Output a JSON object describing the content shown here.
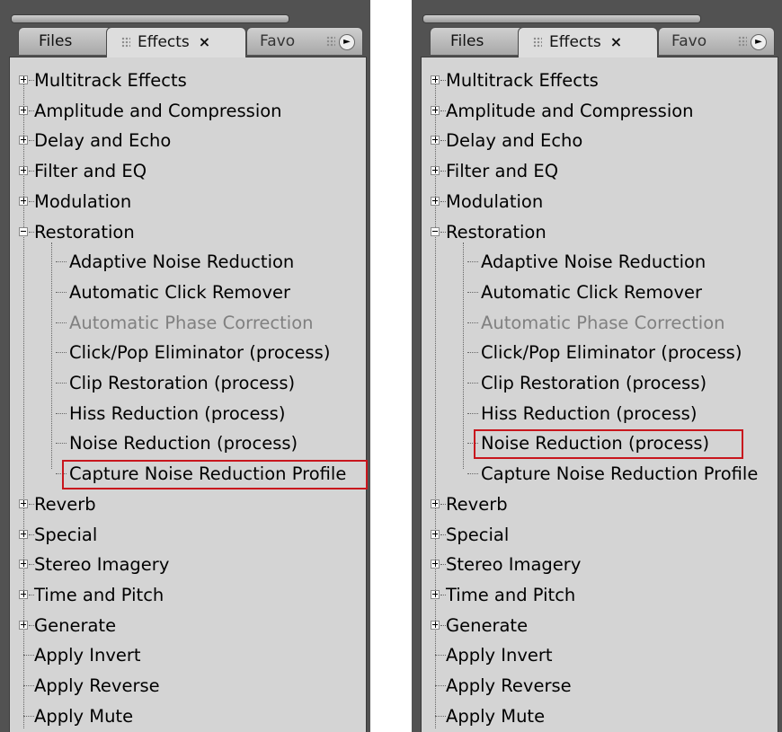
{
  "tabs": {
    "files": "Files",
    "effects": "Effects",
    "effects_close": "×",
    "favorites": "Favo",
    "menu_glyph": "►"
  },
  "tree": [
    {
      "label": "Multitrack Effects",
      "level": 0,
      "type": "collapsed"
    },
    {
      "label": "Amplitude and Compression",
      "level": 0,
      "type": "collapsed"
    },
    {
      "label": "Delay and Echo",
      "level": 0,
      "type": "collapsed"
    },
    {
      "label": "Filter and EQ",
      "level": 0,
      "type": "collapsed"
    },
    {
      "label": "Modulation",
      "level": 0,
      "type": "collapsed"
    },
    {
      "label": "Restoration",
      "level": 0,
      "type": "expanded"
    },
    {
      "label": "Adaptive Noise Reduction",
      "level": 1,
      "type": "leaf"
    },
    {
      "label": "Automatic Click Remover",
      "level": 1,
      "type": "leaf"
    },
    {
      "label": "Automatic Phase Correction",
      "level": 1,
      "type": "leaf",
      "disabled": true
    },
    {
      "label": "Click/Pop Eliminator (process)",
      "level": 1,
      "type": "leaf"
    },
    {
      "label": "Clip Restoration (process)",
      "level": 1,
      "type": "leaf"
    },
    {
      "label": "Hiss Reduction (process)",
      "level": 1,
      "type": "leaf"
    },
    {
      "label": "Noise Reduction (process)",
      "level": 1,
      "type": "leaf"
    },
    {
      "label": "Capture Noise Reduction Profile",
      "level": 1,
      "type": "leaf",
      "last_child": true
    },
    {
      "label": "Reverb",
      "level": 0,
      "type": "collapsed"
    },
    {
      "label": "Special",
      "level": 0,
      "type": "collapsed"
    },
    {
      "label": "Stereo Imagery",
      "level": 0,
      "type": "collapsed"
    },
    {
      "label": "Time and Pitch",
      "level": 0,
      "type": "collapsed"
    },
    {
      "label": "Generate",
      "level": 0,
      "type": "collapsed"
    },
    {
      "label": "Apply Invert",
      "level": 0,
      "type": "leaf"
    },
    {
      "label": "Apply Reverse",
      "level": 0,
      "type": "leaf"
    },
    {
      "label": "Apply Mute",
      "level": 0,
      "type": "leaf"
    }
  ],
  "panels": [
    {
      "id": "panel-left",
      "highlighted_item": "Capture Noise Reduction Profile"
    },
    {
      "id": "panel-right",
      "highlighted_item": "Noise Reduction (process)"
    }
  ],
  "colors": {
    "highlight": "#c8161d",
    "disabled_text": "#808080",
    "tree_background": "#d4d4d4"
  }
}
